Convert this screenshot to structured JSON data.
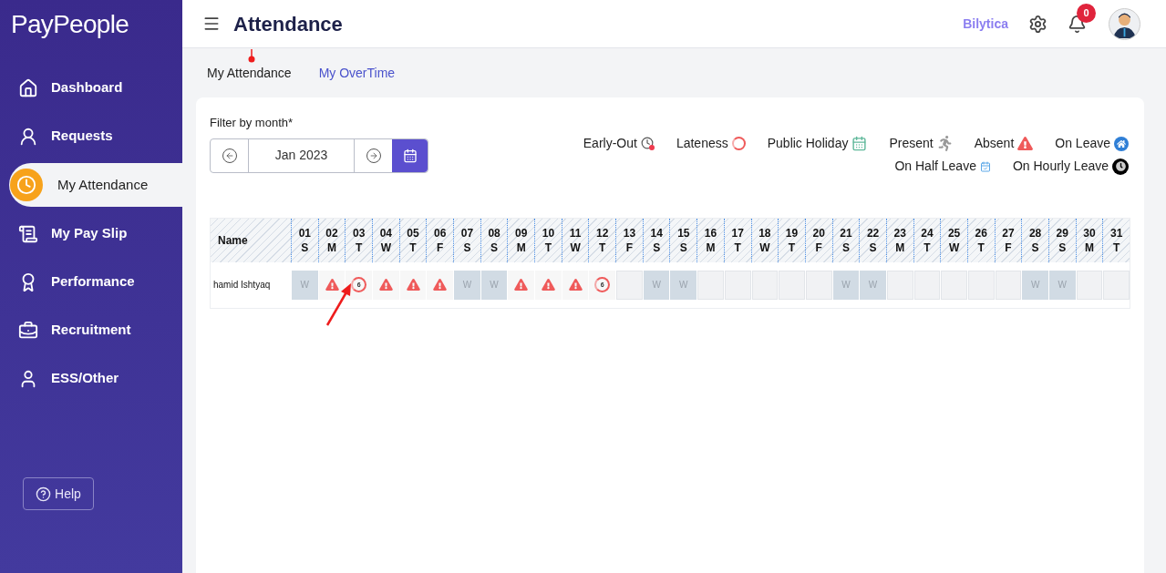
{
  "brand": "PayPeople",
  "sidebar": {
    "items": [
      {
        "label": "Dashboard",
        "selected": false
      },
      {
        "label": "Requests",
        "selected": false
      },
      {
        "label": "My Attendance",
        "selected": true
      },
      {
        "label": "My Pay Slip",
        "selected": false
      },
      {
        "label": "Performance",
        "selected": false
      },
      {
        "label": "Recruitment",
        "selected": false
      },
      {
        "label": "ESS/Other",
        "selected": false
      }
    ],
    "help": "Help"
  },
  "header": {
    "title": "Attendance",
    "company": "Bilytica",
    "notifications": "0"
  },
  "tabs": [
    {
      "label": "My Attendance",
      "selected": true
    },
    {
      "label": "My OverTime",
      "selected": false
    }
  ],
  "filter": {
    "label": "Filter by month*",
    "value": "Jan 2023"
  },
  "legend": [
    {
      "label": "Early-Out",
      "kind": "early"
    },
    {
      "label": "Lateness",
      "kind": "late"
    },
    {
      "label": "Public Holiday",
      "kind": "holiday"
    },
    {
      "label": "Present",
      "kind": "present"
    },
    {
      "label": "Absent",
      "kind": "absent"
    },
    {
      "label": "On Leave",
      "kind": "leave"
    },
    {
      "label": "On Half Leave",
      "kind": "half"
    },
    {
      "label": "On Hourly Leave",
      "kind": "hourly"
    }
  ],
  "table": {
    "name_header": "Name",
    "days": [
      {
        "day": "01",
        "weekday": "S"
      },
      {
        "day": "02",
        "weekday": "M"
      },
      {
        "day": "03",
        "weekday": "T"
      },
      {
        "day": "04",
        "weekday": "W"
      },
      {
        "day": "05",
        "weekday": "T"
      },
      {
        "day": "06",
        "weekday": "F"
      },
      {
        "day": "07",
        "weekday": "S"
      },
      {
        "day": "08",
        "weekday": "S"
      },
      {
        "day": "09",
        "weekday": "M"
      },
      {
        "day": "10",
        "weekday": "T"
      },
      {
        "day": "11",
        "weekday": "W"
      },
      {
        "day": "12",
        "weekday": "T"
      },
      {
        "day": "13",
        "weekday": "F"
      },
      {
        "day": "14",
        "weekday": "S"
      },
      {
        "day": "15",
        "weekday": "S"
      },
      {
        "day": "16",
        "weekday": "M"
      },
      {
        "day": "17",
        "weekday": "T"
      },
      {
        "day": "18",
        "weekday": "W"
      },
      {
        "day": "19",
        "weekday": "T"
      },
      {
        "day": "20",
        "weekday": "F"
      },
      {
        "day": "21",
        "weekday": "S"
      },
      {
        "day": "22",
        "weekday": "S"
      },
      {
        "day": "23",
        "weekday": "M"
      },
      {
        "day": "24",
        "weekday": "T"
      },
      {
        "day": "25",
        "weekday": "W"
      },
      {
        "day": "26",
        "weekday": "T"
      },
      {
        "day": "27",
        "weekday": "F"
      },
      {
        "day": "28",
        "weekday": "S"
      },
      {
        "day": "29",
        "weekday": "S"
      },
      {
        "day": "30",
        "weekday": "M"
      },
      {
        "day": "31",
        "weekday": "T"
      }
    ],
    "rows": [
      {
        "name": "hamid Ishtyaq",
        "cells": [
          {
            "kind": "weekend",
            "text": "W"
          },
          {
            "kind": "absent"
          },
          {
            "kind": "late",
            "text": "6"
          },
          {
            "kind": "absent"
          },
          {
            "kind": "absent"
          },
          {
            "kind": "absent"
          },
          {
            "kind": "weekend",
            "text": "W"
          },
          {
            "kind": "weekend",
            "text": "W"
          },
          {
            "kind": "absent"
          },
          {
            "kind": "absent"
          },
          {
            "kind": "absent"
          },
          {
            "kind": "late",
            "text": "6"
          },
          {
            "kind": "none"
          },
          {
            "kind": "weekend",
            "text": "W"
          },
          {
            "kind": "weekend",
            "text": "W"
          },
          {
            "kind": "none"
          },
          {
            "kind": "none"
          },
          {
            "kind": "none"
          },
          {
            "kind": "none"
          },
          {
            "kind": "none"
          },
          {
            "kind": "weekend",
            "text": "W"
          },
          {
            "kind": "weekend",
            "text": "W"
          },
          {
            "kind": "none"
          },
          {
            "kind": "none"
          },
          {
            "kind": "none"
          },
          {
            "kind": "none"
          },
          {
            "kind": "none"
          },
          {
            "kind": "weekend",
            "text": "W"
          },
          {
            "kind": "weekend",
            "text": "W"
          },
          {
            "kind": "none"
          },
          {
            "kind": "none"
          }
        ]
      }
    ]
  }
}
